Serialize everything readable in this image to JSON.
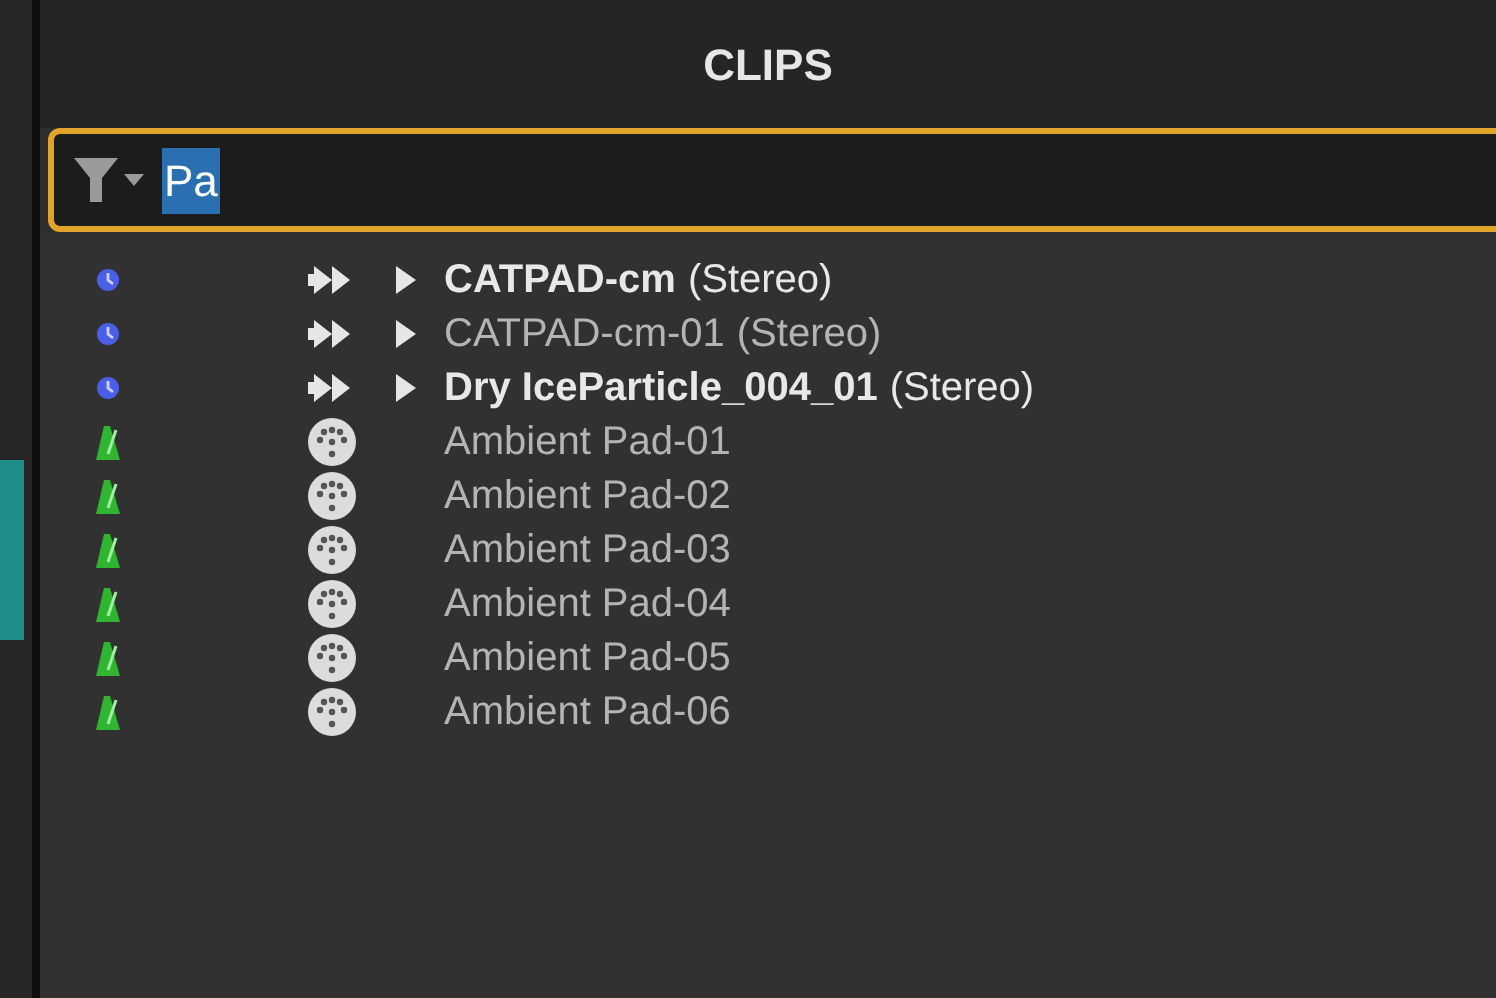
{
  "panel": {
    "title": "CLIPS"
  },
  "search": {
    "value": "Pa"
  },
  "clips": [
    {
      "kind": "audio",
      "name": "CATPAD-cm",
      "suffix": "(Stereo)",
      "bold": true
    },
    {
      "kind": "audio",
      "name": "CATPAD-cm-01",
      "suffix": "(Stereo)",
      "bold": false
    },
    {
      "kind": "audio",
      "name": "Dry IceParticle_004_01",
      "suffix": "(Stereo)",
      "bold": true
    },
    {
      "kind": "midi",
      "name": "Ambient Pad-01",
      "bold": false
    },
    {
      "kind": "midi",
      "name": "Ambient Pad-02",
      "bold": false
    },
    {
      "kind": "midi",
      "name": "Ambient Pad-03",
      "bold": false
    },
    {
      "kind": "midi",
      "name": "Ambient Pad-04",
      "bold": false
    },
    {
      "kind": "midi",
      "name": "Ambient Pad-05",
      "bold": false
    },
    {
      "kind": "midi",
      "name": "Ambient Pad-06",
      "bold": false
    }
  ]
}
